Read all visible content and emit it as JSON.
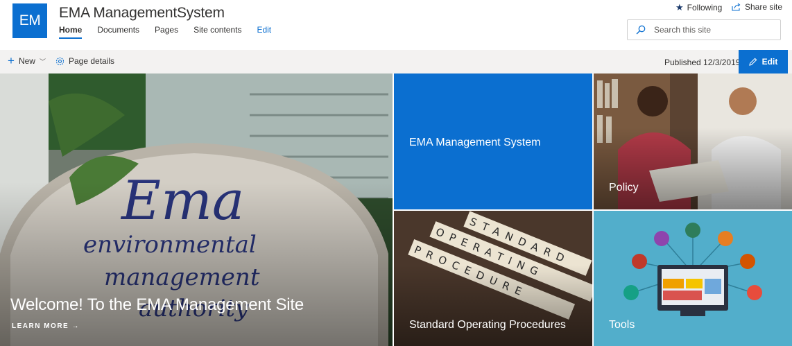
{
  "site": {
    "logo_text": "EM",
    "title": "EMA ManagementSystem",
    "accent": "#0b6fd0"
  },
  "nav": {
    "items": [
      {
        "label": "Home",
        "active": true
      },
      {
        "label": "Documents"
      },
      {
        "label": "Pages"
      },
      {
        "label": "Site contents"
      }
    ],
    "edit_label": "Edit"
  },
  "header_actions": {
    "following_label": "Following",
    "following_icon": "star-icon",
    "share_label": "Share site",
    "share_icon": "share-icon"
  },
  "search": {
    "placeholder": "Search this site",
    "icon": "search-icon"
  },
  "command_bar": {
    "new_label": "New",
    "page_details_label": "Page details",
    "published_text": "Published 12/3/2019",
    "edit_label": "Edit"
  },
  "hero": {
    "main": {
      "title": "Welcome! To the EMA Management Site",
      "link_label": "LEARN MORE →",
      "image": "ema-sign-photo"
    },
    "tiles": [
      {
        "label": "EMA Management System",
        "color": "#0b6fd0"
      },
      {
        "label": "Policy",
        "image": "two-people-reviewing-document-photo"
      },
      {
        "label": "Standard Operating Procedures",
        "image": "scrabble-tiles-photo"
      },
      {
        "label": "Tools",
        "image": "computer-network-illustration"
      }
    ]
  }
}
